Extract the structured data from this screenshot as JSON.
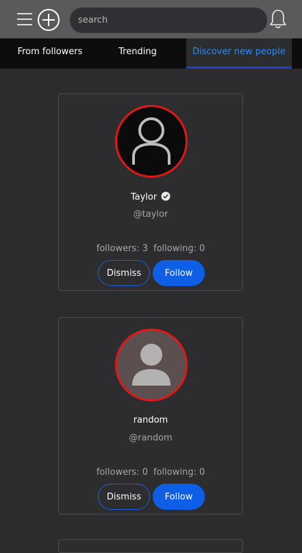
{
  "header": {
    "search_placeholder": "search"
  },
  "tabs": [
    {
      "label": "From followers"
    },
    {
      "label": "Trending"
    },
    {
      "label": "Discover new people",
      "active": true
    }
  ],
  "users": [
    {
      "name": "Taylor",
      "handle": "@taylor",
      "verified": true,
      "followers_label": "followers: 3",
      "following_label": "following: 0",
      "dismiss_label": "Dismiss",
      "follow_label": "Follow"
    },
    {
      "name": "random",
      "handle": "@random",
      "verified": false,
      "followers_label": "followers: 0",
      "following_label": "following: 0",
      "dismiss_label": "Dismiss",
      "follow_label": "Follow"
    }
  ],
  "colors": {
    "accent": "#0f5fe6",
    "active_tab_text": "#2b8cf6",
    "avatar_ring": "#e01818",
    "background": "#2b2c2e"
  }
}
